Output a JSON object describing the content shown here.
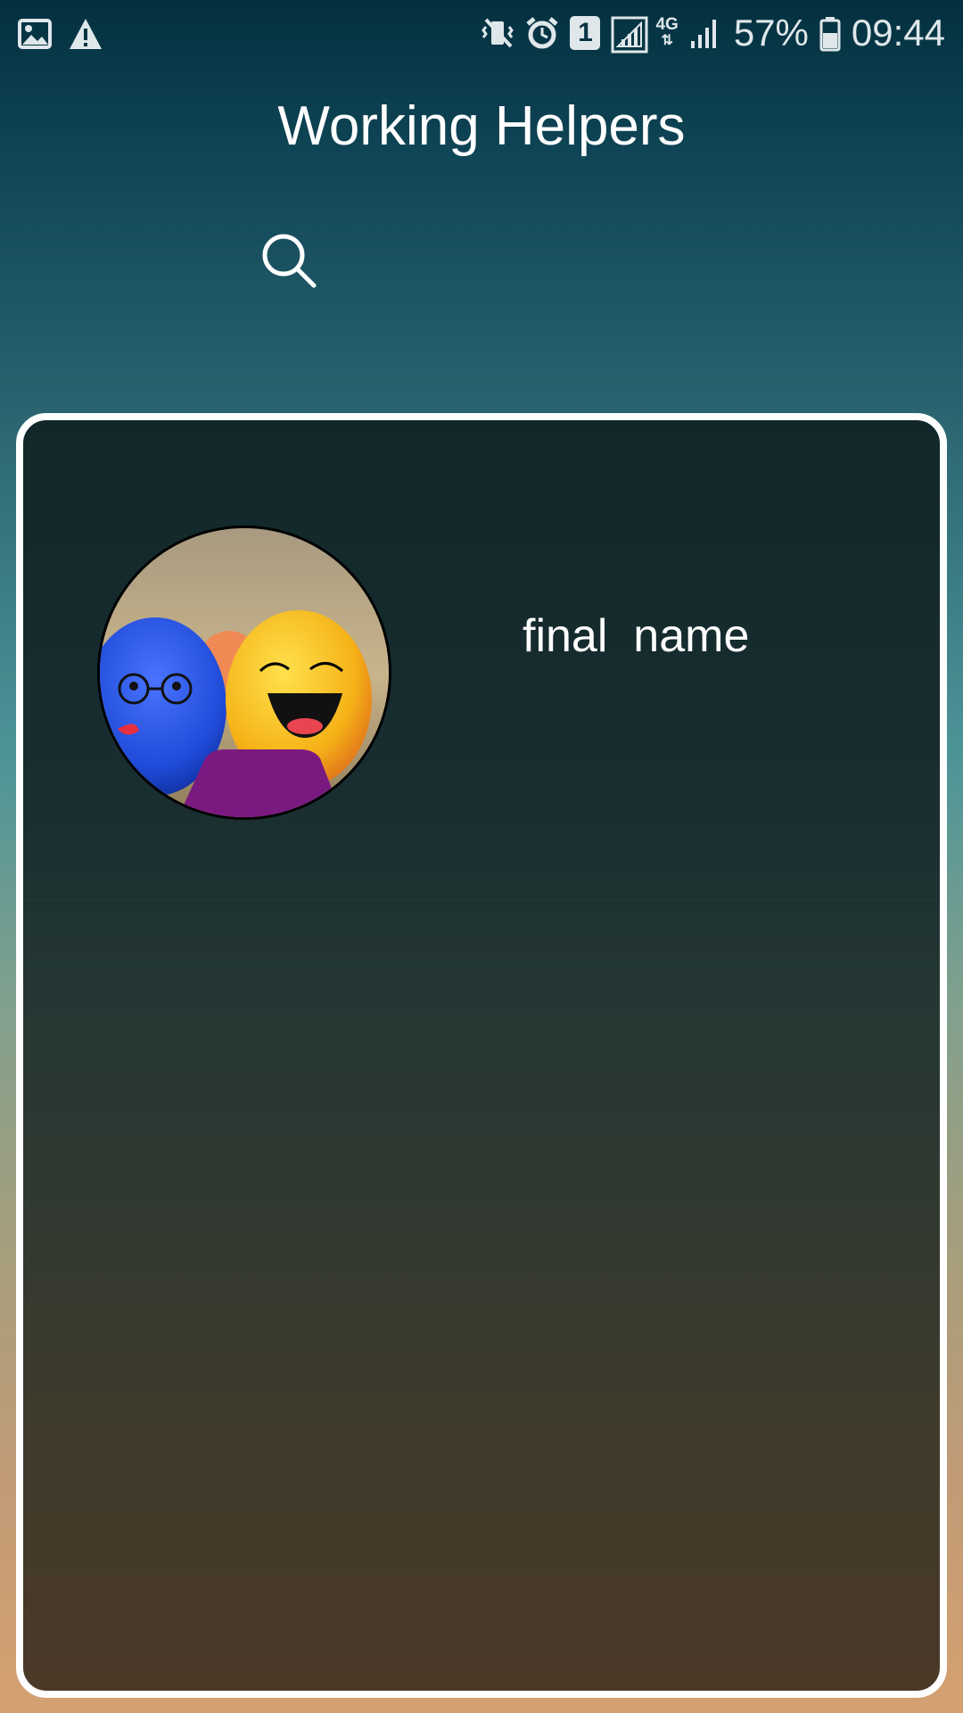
{
  "status_bar": {
    "left_icons": [
      "image-icon",
      "warning-icon"
    ],
    "right_icons": [
      "vibrate-mute-icon",
      "alarm-icon",
      "sim-1-icon",
      "signal-icon",
      "network-4g-icon",
      "signal-2-icon",
      "battery-icon"
    ],
    "sim_slot": "1",
    "network_type": "4G",
    "battery": "57%",
    "time": "09:44"
  },
  "header": {
    "title": "Working Helpers",
    "search_icon": "search-icon"
  },
  "list": {
    "items": [
      {
        "name": "final  name",
        "avatar": "easter-eggs-photo"
      }
    ]
  }
}
